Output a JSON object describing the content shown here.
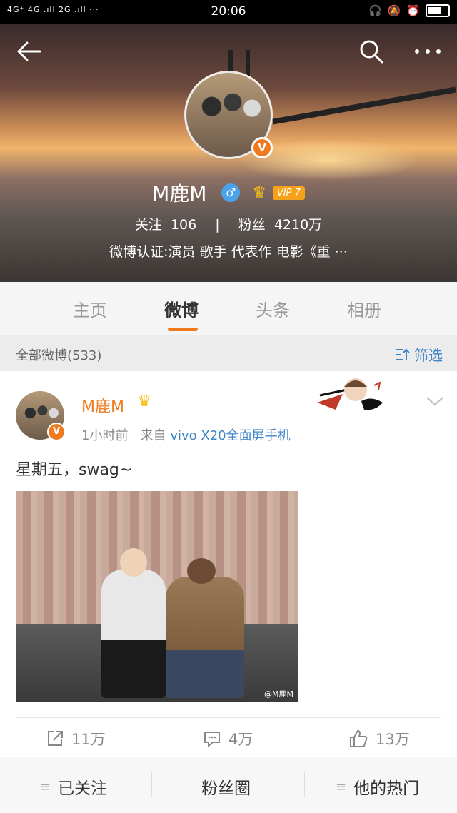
{
  "status_bar": {
    "network": "4G⁺ 4G .ıll 2G .ıll ···",
    "time": "20:06"
  },
  "profile": {
    "username": "M鹿M",
    "vip_label": "VIP 7",
    "following_label": "关注",
    "following_count": "106",
    "followers_label": "粉丝",
    "followers_count": "4210万",
    "verification": "微博认证:演员 歌手 代表作 电影《重 ···"
  },
  "tabs": [
    "主页",
    "微博",
    "头条",
    "相册"
  ],
  "filter_bar": {
    "title": "全部微博(533)",
    "filter_label": "筛选"
  },
  "post": {
    "author": "M鹿M",
    "time": "1小时前",
    "source_prefix": "来自",
    "source": "vivo X20全面屏手机",
    "text": "星期五，swag~",
    "image_watermark": "@M鹿M",
    "reposts": "11万",
    "comments": "4万",
    "likes": "13万"
  },
  "bottom_bar": {
    "followed": "已关注",
    "fan_circle": "粉丝圈",
    "his_hot": "他的热门"
  },
  "colors": {
    "accent": "#f07b1e",
    "link": "#3d84c5",
    "vip": "#f5a21a"
  }
}
